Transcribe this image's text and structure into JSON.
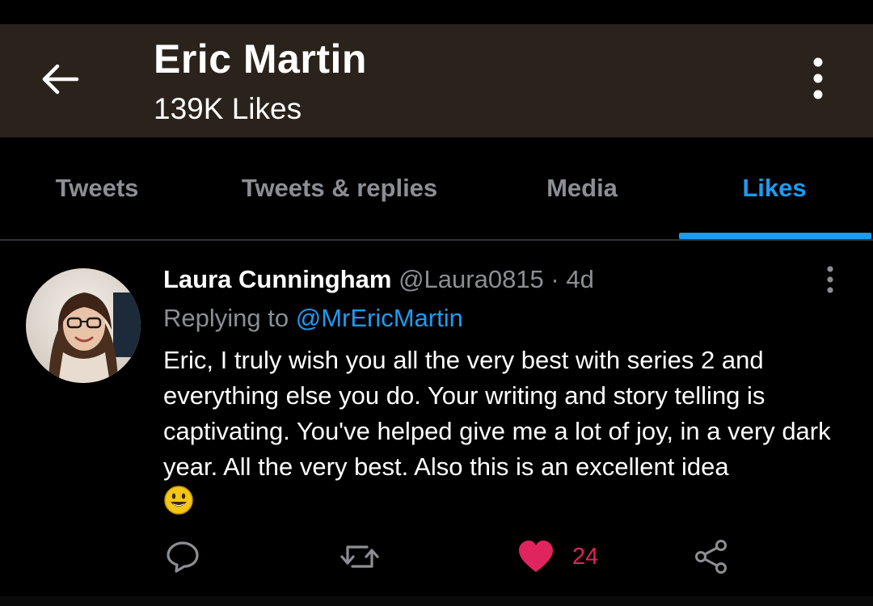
{
  "header": {
    "back_icon": "arrow-left-icon",
    "title": "Eric Martin",
    "subtitle": "139K Likes",
    "more_icon": "vertical-dots-icon"
  },
  "tabs": [
    {
      "label": "Tweets",
      "active": false
    },
    {
      "label": "Tweets & replies",
      "active": false
    },
    {
      "label": "Media",
      "active": false
    },
    {
      "label": "Likes",
      "active": true
    }
  ],
  "tweet": {
    "author_name": "Laura Cunningham",
    "author_handle": "@Laura0815",
    "separator": "·",
    "time": "4d",
    "replying_prefix": "Replying to",
    "replying_handle": "@MrEricMartin",
    "text": "Eric, I truly wish you all the very best with series 2 and everything else you do. Your writing and story telling is captivating. You've helped give me a lot of joy, in a very dark year. All the very best. Also this is an excellent idea",
    "emoji": "smiley-emoji",
    "actions": {
      "reply_icon": "reply-bubble-icon",
      "retweet_icon": "retweet-icon",
      "like_icon": "heart-icon",
      "like_count": "24",
      "share_icon": "share-icon"
    }
  },
  "colors": {
    "header_bg": "#2a231b",
    "accent": "#1d9bf0",
    "like": "#e0245e",
    "muted": "#8b8f94",
    "background": "#000000"
  }
}
